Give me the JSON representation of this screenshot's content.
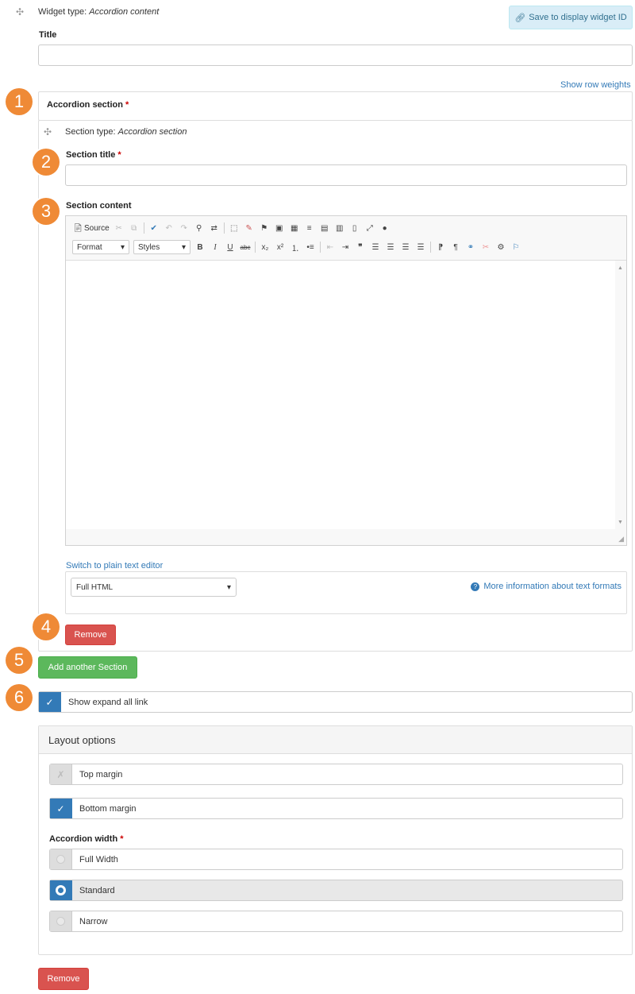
{
  "widget": {
    "type_prefix": "Widget type:",
    "type_value": "Accordion content",
    "save_button": "Save to display widget ID",
    "title_label": "Title",
    "title_value": ""
  },
  "show_row_weights": "Show row weights",
  "accordion": {
    "header": "Accordion section",
    "required_mark": "*",
    "section_type_prefix": "Section type:",
    "section_type_value": "Accordion section",
    "section_title_label": "Section title",
    "section_title_value": "",
    "section_content_label": "Section content",
    "editor": {
      "source_label": "Source",
      "format_label": "Format",
      "styles_label": "Styles",
      "bold": "B",
      "italic": "I",
      "underline": "U",
      "strike": "abc",
      "content": ""
    },
    "switch_link": "Switch to plain text editor",
    "format_select": "Full HTML",
    "more_info_link": "More information about text formats",
    "remove_button": "Remove"
  },
  "add_another_button": "Add another Section",
  "show_expand_all": {
    "label": "Show expand all link",
    "checked": true
  },
  "layout_options": {
    "header": "Layout options",
    "top_margin": {
      "label": "Top margin",
      "checked": false
    },
    "bottom_margin": {
      "label": "Bottom margin",
      "checked": true
    },
    "width_label": "Accordion width",
    "width_options": [
      {
        "label": "Full Width",
        "selected": false
      },
      {
        "label": "Standard",
        "selected": true
      },
      {
        "label": "Narrow",
        "selected": false
      }
    ]
  },
  "remove_button": "Remove",
  "badges": [
    "1",
    "2",
    "3",
    "4",
    "5",
    "6"
  ],
  "colors": {
    "badge": "#ef8a36",
    "primary": "#337ab7",
    "danger": "#d9534f",
    "success": "#5cb85c"
  }
}
